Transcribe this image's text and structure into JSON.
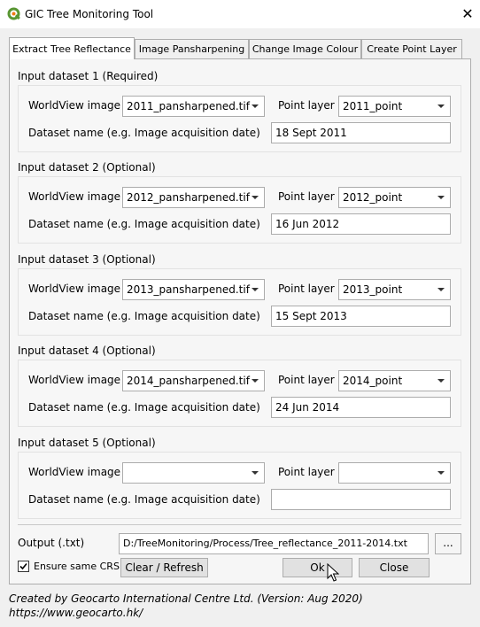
{
  "window": {
    "title": "GIC Tree Monitoring Tool",
    "close_glyph": "✕",
    "accent_color": "#589632"
  },
  "tabs": [
    {
      "label": "Extract Tree Reflectance",
      "active": true
    },
    {
      "label": "Image Pansharpening",
      "active": false
    },
    {
      "label": "Change Image Colour",
      "active": false
    },
    {
      "label": "Create Point Layer",
      "active": false
    }
  ],
  "datasets": [
    {
      "title": "Input dataset 1 (Required)",
      "image_label": "WorldView image",
      "image_value": "2011_pansharpened.tif",
      "point_label": "Point layer",
      "point_value": "2011_point",
      "name_label": "Dataset name (e.g. Image acquisition date)",
      "name_value": "18 Sept 2011"
    },
    {
      "title": "Input dataset 2 (Optional)",
      "image_label": "WorldView image",
      "image_value": "2012_pansharpened.tif",
      "point_label": "Point layer",
      "point_value": "2012_point",
      "name_label": "Dataset name (e.g. Image acquisition date)",
      "name_value": "16 Jun 2012"
    },
    {
      "title": "Input dataset 3 (Optional)",
      "image_label": "WorldView image",
      "image_value": "2013_pansharpened.tif",
      "point_label": "Point layer",
      "point_value": "2013_point",
      "name_label": "Dataset name (e.g. Image acquisition date)",
      "name_value": "15 Sept 2013"
    },
    {
      "title": "Input dataset 4 (Optional)",
      "image_label": "WorldView image",
      "image_value": "2014_pansharpened.tif",
      "point_label": "Point layer",
      "point_value": "2014_point",
      "name_label": "Dataset name (e.g. Image acquisition date)",
      "name_value": "24 Jun 2014"
    },
    {
      "title": "Input dataset 5 (Optional)",
      "image_label": "WorldView image",
      "image_value": "",
      "point_label": "Point layer",
      "point_value": "",
      "name_label": "Dataset name (e.g. Image acquisition date)",
      "name_value": ""
    }
  ],
  "output": {
    "label": "Output (.txt)",
    "value": "D:/TreeMonitoring/Process/Tree_reflectance_2011-2014.txt",
    "browse_label": "..."
  },
  "options": {
    "same_crs_label": "Ensure same CRS",
    "same_crs_checked": true
  },
  "buttons": {
    "clear_label": "Clear / Refresh",
    "ok_label": "Ok",
    "close_label": "Close"
  },
  "footer": {
    "credit": "Created by Geocarto International Centre Ltd. (Version: Aug 2020)",
    "url": "https://www.geocarto.hk/"
  }
}
